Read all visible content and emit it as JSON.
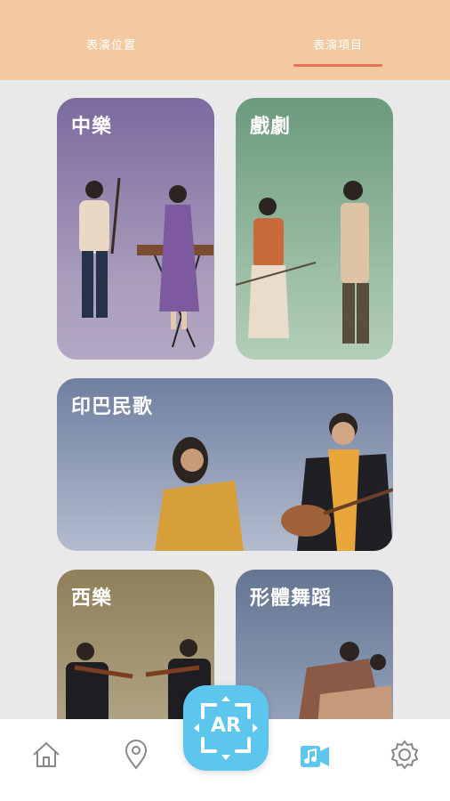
{
  "tabs": {
    "location_label": "表演位置",
    "performance_label": "表演項目",
    "active": "performance"
  },
  "categories": [
    {
      "title": "中樂"
    },
    {
      "title": "戲劇"
    },
    {
      "title": "印巴民歌"
    },
    {
      "title": "西樂"
    },
    {
      "title": "形體舞蹈"
    }
  ],
  "bottom_nav": {
    "home_icon": "home-icon",
    "location_icon": "map-pin-icon",
    "ar_label": "AR",
    "performance_icon": "music-video-icon",
    "settings_icon": "gear-icon",
    "active_color": "#5cc6ec"
  },
  "colors": {
    "header": "#f2c9a0",
    "tab_indicator": "#e8735b",
    "ar_button": "#5cc6ec"
  }
}
